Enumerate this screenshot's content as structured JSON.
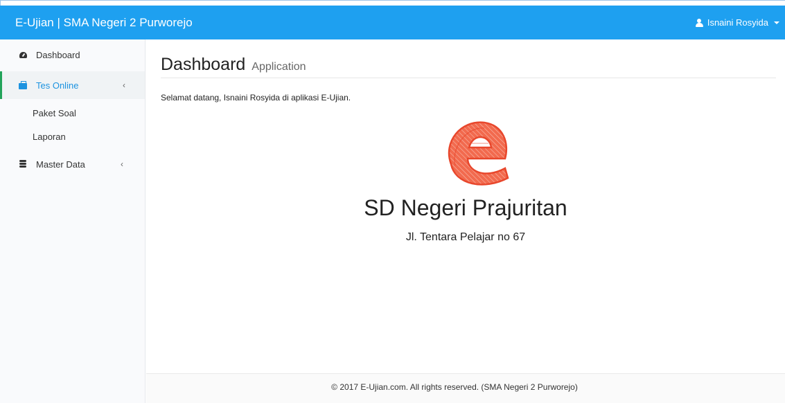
{
  "header": {
    "brand": "E-Ujian | SMA Negeri 2 Purworejo",
    "user_name": "Isnaini Rosyida"
  },
  "sidebar": {
    "items": [
      {
        "label": "Dashboard",
        "icon": "dashboard-icon"
      },
      {
        "label": "Tes Online",
        "icon": "briefcase-icon",
        "active": true,
        "chevron": "‹"
      },
      {
        "label": "Paket Soal"
      },
      {
        "label": "Laporan"
      },
      {
        "label": "Master Data",
        "icon": "database-icon",
        "chevron": "‹"
      }
    ]
  },
  "main": {
    "title": "Dashboard",
    "subtitle": "Application",
    "welcome": "Selamat datang, Isnaini Rosyida di aplikasi E-Ujian.",
    "school_name": "SD Negeri Prajuritan",
    "address": "Jl. Tentara Pelajar no 67"
  },
  "footer": {
    "text": "© 2017 E-Ujian.com. All rights reserved. (SMA Negeri 2 Purworejo)"
  },
  "colors": {
    "topbar": "#1ea0f0",
    "active_accent": "#22a35a",
    "active_text": "#1c93e0",
    "logo": "#f0573a"
  }
}
